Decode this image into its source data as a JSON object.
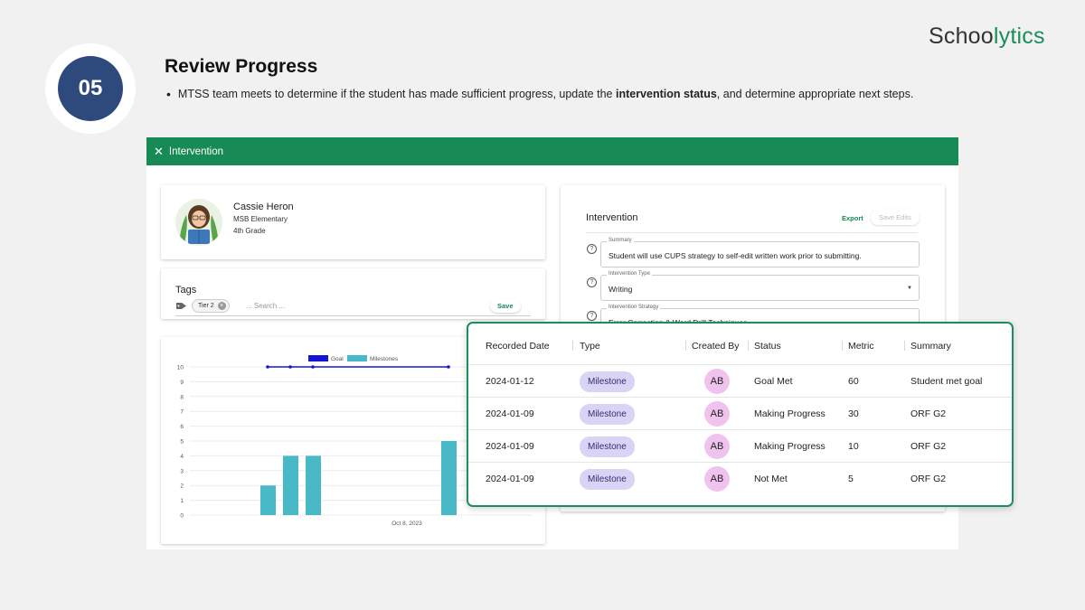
{
  "step": {
    "number": "05"
  },
  "title": "Review Progress",
  "bullet": {
    "before": "MTSS team meets to determine if the student has made sufficient progress, update the ",
    "bold": "intervention status",
    "after": ", and determine appropriate next steps."
  },
  "brand": {
    "part1": "Schoo",
    "part2": "lytics"
  },
  "panel": {
    "title": "Intervention",
    "close_icon": "close-icon"
  },
  "student": {
    "name": "Cassie Heron",
    "school": "MSB Elementary",
    "grade": "4th Grade"
  },
  "tags": {
    "title": "Tags",
    "chips": [
      "Tier 2"
    ],
    "search_placeholder": "... Search ...",
    "save_label": "Save"
  },
  "chart_data": {
    "type": "bar",
    "legend": [
      "Goal",
      "Milestones"
    ],
    "legend_placement": "top",
    "ylim": [
      0,
      10
    ],
    "yticks": [
      "0",
      "1",
      "2",
      "3",
      "4",
      "5",
      "6",
      "7",
      "8",
      "9",
      "10"
    ],
    "x_tick_label": "Oct 8, 2023",
    "milestones": [
      2,
      4,
      4,
      5
    ],
    "goal": [
      10,
      10,
      10,
      10
    ],
    "colors": {
      "goal": "#1515d6",
      "milestones": "#49b9c8"
    }
  },
  "intervention": {
    "title": "Intervention",
    "export_label": "Export",
    "save_edits_label": "Save Edits",
    "fields": [
      {
        "label": "Summary",
        "value": "Student will use CUPS strategy to self-edit written work prior to submitting."
      },
      {
        "label": "Intervention Type",
        "value": "Writing"
      },
      {
        "label": "Intervention Strategy",
        "value": "Error Correction & Word Drill Techniques"
      }
    ]
  },
  "table": {
    "headers": [
      "Recorded Date",
      "Type",
      "Created By",
      "Status",
      "Metric",
      "Summary"
    ],
    "rows": [
      {
        "date": "2024-01-12",
        "type": "Milestone",
        "created_by": "AB",
        "status": "Goal Met",
        "metric": "60",
        "summary": "Student met goal"
      },
      {
        "date": "2024-01-09",
        "type": "Milestone",
        "created_by": "AB",
        "status": "Making Progress",
        "metric": "30",
        "summary": "ORF G2"
      },
      {
        "date": "2024-01-09",
        "type": "Milestone",
        "created_by": "AB",
        "status": "Making Progress",
        "metric": "10",
        "summary": "ORF G2"
      },
      {
        "date": "2024-01-09",
        "type": "Milestone",
        "created_by": "AB",
        "status": "Not Met",
        "metric": "5",
        "summary": "ORF G2"
      }
    ]
  }
}
